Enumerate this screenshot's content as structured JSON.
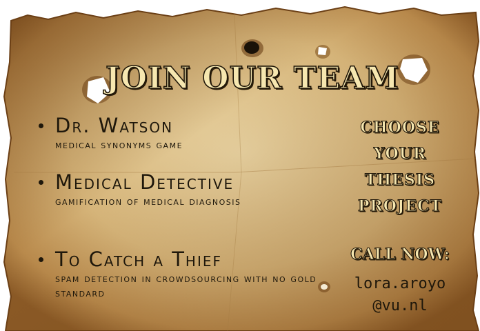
{
  "poster": {
    "title": "JOIN OUR TEAM",
    "items": [
      {
        "title": "Dr. Watson",
        "subtitle": "MEDICAL SYNONYMS GAME"
      },
      {
        "title": "Medical Detective",
        "subtitle": "GAMIFICATION OF MEDICAL DIAGNOSIS"
      },
      {
        "title": "To Catch a Thief",
        "subtitle": "SPAM DETECTION IN CROWDSOURCING WITH NO GOLD STANDARD"
      }
    ],
    "sidebar": {
      "choose_lines": [
        "CHOOSE",
        "YOUR",
        "THESIS",
        "PROJECT"
      ],
      "call_now": "CALL NOW:",
      "contact_lines": [
        "lora.aroyo",
        "@vu.nl"
      ]
    }
  },
  "colors": {
    "paper": "#d8b980",
    "paper_edge": "#7a4d1c",
    "ink": "#1e170b",
    "headline_fill": "#f6e7b0"
  }
}
